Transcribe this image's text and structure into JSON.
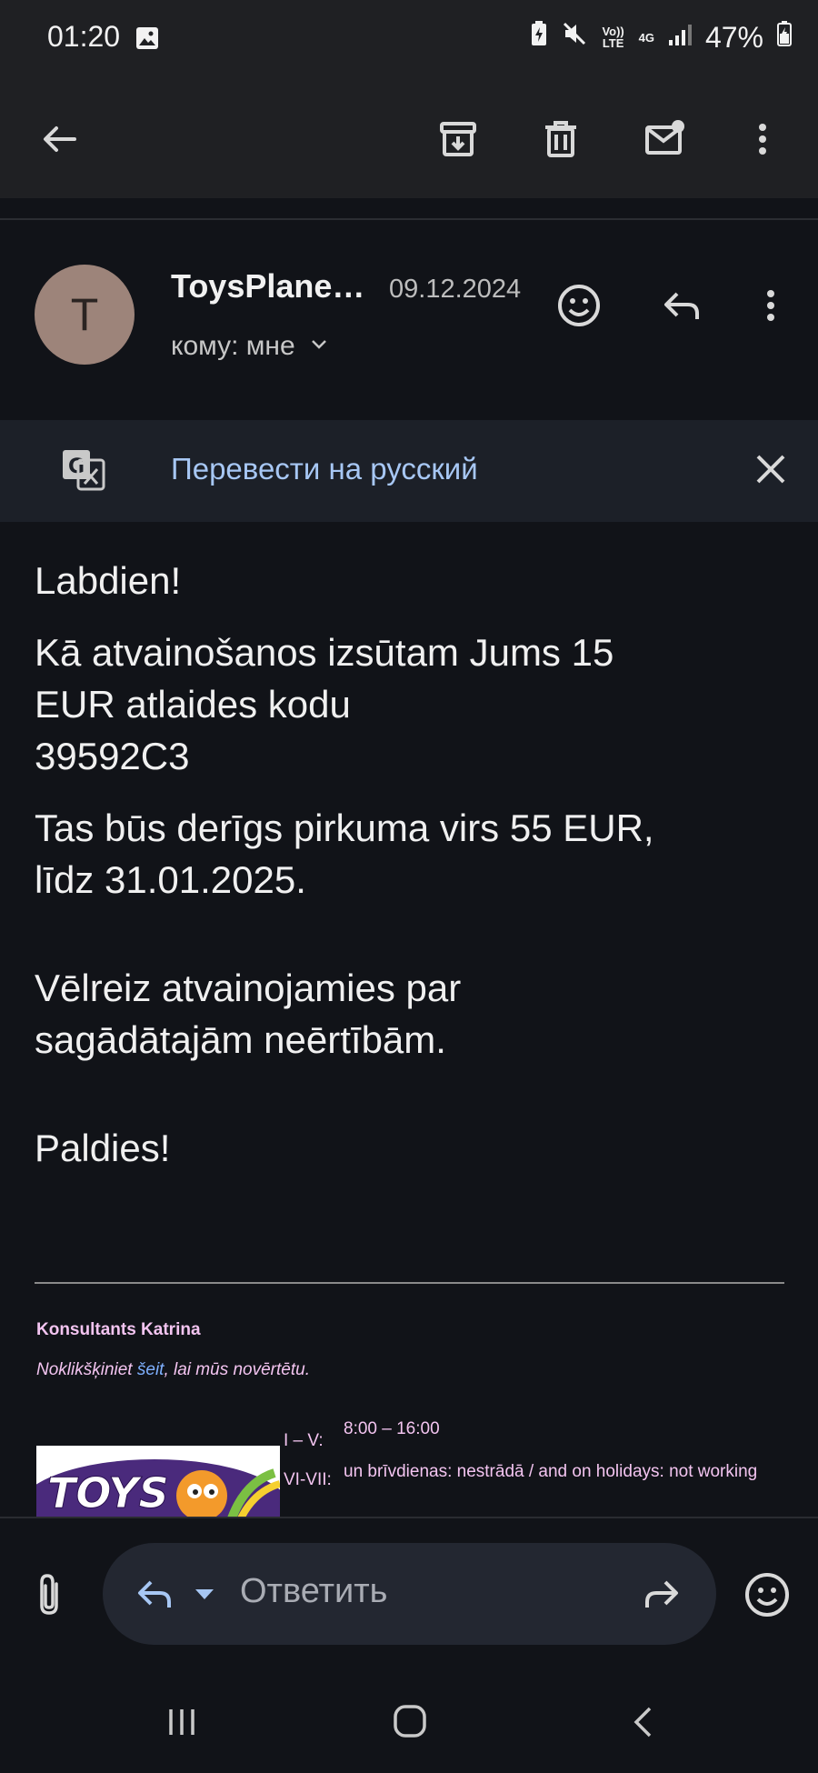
{
  "status_bar": {
    "time": "01:20",
    "volte_label": "Vo)) LTE",
    "network_label": "4G",
    "battery": "47%"
  },
  "app_bar": {
    "icons": [
      "back-arrow-icon",
      "archive-icon",
      "delete-icon",
      "mark-unread-icon",
      "more-vert-icon"
    ]
  },
  "message": {
    "avatar_letter": "T",
    "sender": "ToysPlane…",
    "date": "09.12.2024",
    "recipient": "кому: мне"
  },
  "translate_bar": {
    "label": "Перевести на русский"
  },
  "body": {
    "greeting": "Labdien!",
    "line1": "Kā atvainošanos izsūtam Jums 15",
    "line2": "EUR atlaides kodu",
    "code": "39592C3",
    "line3": "Tas būs derīgs pirkuma virs 55 EUR,",
    "line4": "līdz 31.01.2025.",
    "line5": "Vēlreiz atvainojamies par",
    "line6": "sagādātajām neērtībām.",
    "closing": "Paldies!"
  },
  "signature": {
    "name": "Konsultants Katrina",
    "note_before": "Noklikšķiniet ",
    "note_link": "šeit",
    "note_after": ", lai mūs novērtētu.",
    "hours_label_1": "I – V:",
    "hours_value_1": "8:00 – 16:00",
    "hours_label_2": "VI-VII:",
    "hours_value_2": "un brīvdienas: nestrādā / and on holidays: not working",
    "logo_text": "TOYS"
  },
  "compose": {
    "placeholder": "Ответить"
  },
  "colors": {
    "background": "#111318",
    "appbar": "#1f2023",
    "translate_bar": "#1c2028",
    "link_blue": "#a7c7f4",
    "signature_pink": "#f3c4f0",
    "avatar": "#9d847a"
  }
}
